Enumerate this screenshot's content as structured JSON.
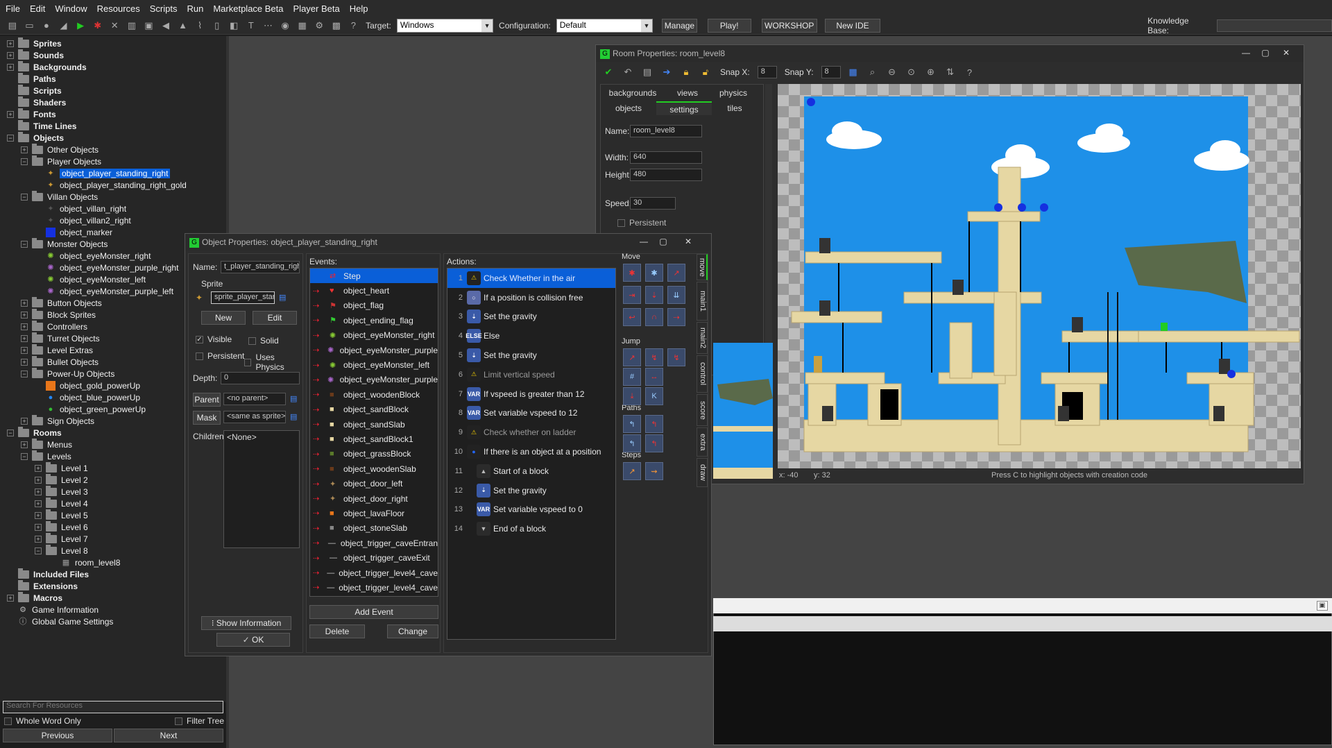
{
  "menu": [
    "File",
    "Edit",
    "Window",
    "Resources",
    "Scripts",
    "Run",
    "Marketplace Beta",
    "Player Beta",
    "Help"
  ],
  "toolbar": {
    "target_label": "Target:",
    "target_value": "Windows",
    "config_label": "Configuration:",
    "config_value": "Default",
    "manage": "Manage",
    "play": "Play!",
    "workshop": "WORKSHOP",
    "new_ide": "New IDE",
    "kb_label": "Knowledge Base:"
  },
  "tree": {
    "sprites": "Sprites",
    "sounds": "Sounds",
    "backgrounds": "Backgrounds",
    "paths": "Paths",
    "scripts": "Scripts",
    "shaders": "Shaders",
    "fonts": "Fonts",
    "timelines": "Time Lines",
    "objects": "Objects",
    "other_objects": "Other Objects",
    "player_objects": "Player Objects",
    "p1": "object_player_standing_right",
    "p2": "object_player_standing_right_gold",
    "villan_objects": "Villan Objects",
    "v1": "object_villan_right",
    "v2": "object_villan2_right",
    "v3": "object_marker",
    "monster_objects": "Monster Objects",
    "m1": "object_eyeMonster_right",
    "m2": "object_eyeMonster_purple_right",
    "m3": "object_eyeMonster_left",
    "m4": "object_eyeMonster_purple_left",
    "button_objects": "Button Objects",
    "block_sprites": "Block Sprites",
    "controllers": "Controllers",
    "turret_objects": "Turret Objects",
    "level_extras": "Level Extras",
    "bullet_objects": "Bullet Objects",
    "powerup_objects": "Power-Up Objects",
    "pu1": "object_gold_powerUp",
    "pu2": "object_blue_powerUp",
    "pu3": "object_green_powerUp",
    "sign_objects": "Sign Objects",
    "rooms": "Rooms",
    "menus": "Menus",
    "levels": "Levels",
    "l1": "Level 1",
    "l2": "Level 2",
    "l3": "Level 3",
    "l4": "Level 4",
    "l5": "Level 5",
    "l6": "Level 6",
    "l7": "Level 7",
    "l8": "Level 8",
    "room": "room_level8",
    "included": "Included Files",
    "extensions": "Extensions",
    "macros": "Macros",
    "gameinfo": "Game Information",
    "gamesettings": "Global Game Settings"
  },
  "search": {
    "placeholder": "Search For Resources",
    "whole_word": "Whole Word Only",
    "filter_tree": "Filter Tree",
    "previous": "Previous",
    "next": "Next"
  },
  "objwin": {
    "title": "Object Properties: object_player_standing_right",
    "name_label": "Name:",
    "name_value": "t_player_standing_right",
    "sprite_label": "Sprite",
    "sprite_value": "sprite_player_stan",
    "new": "New",
    "edit": "Edit",
    "visible": "Visible",
    "solid": "Solid",
    "persistent": "Persistent",
    "uses_physics": "Uses Physics",
    "depth_label": "Depth:",
    "depth_value": "0",
    "parent_label": "Parent",
    "parent_value": "<no parent>",
    "mask_label": "Mask",
    "mask_value": "<same as sprite>",
    "children_label": "Children:",
    "children_value": "<None>",
    "show_info": "Show Information",
    "ok": "OK",
    "events_label": "Events:",
    "actions_label": "Actions:",
    "add_event": "Add Event",
    "delete": "Delete",
    "change": "Change",
    "events": [
      "Step",
      "object_heart",
      "object_flag",
      "object_ending_flag",
      "object_eyeMonster_right",
      "object_eyeMonster_purple",
      "object_eyeMonster_left",
      "object_eyeMonster_purple",
      "object_woodenBlock",
      "object_sandBlock",
      "object_sandSlab",
      "object_sandBlock1",
      "object_grassBlock",
      "object_woodenSlab",
      "object_door_left",
      "object_door_right",
      "object_lavaFloor",
      "object_stoneSlab",
      "object_trigger_caveEntran",
      "object_trigger_caveExit",
      "object_trigger_level4_cave",
      "object_trigger_level4_cave"
    ],
    "actions": [
      {
        "n": "1",
        "t": "Check Whether in the air",
        "ic": "warn",
        "indent": 0
      },
      {
        "n": "2",
        "t": "If a position is collision free",
        "ic": "circle",
        "indent": 0
      },
      {
        "n": "3",
        "t": "Set the gravity",
        "ic": "grav",
        "indent": 0
      },
      {
        "n": "4",
        "t": "Else",
        "ic": "else",
        "indent": 0
      },
      {
        "n": "5",
        "t": "Set the gravity",
        "ic": "grav",
        "indent": 0
      },
      {
        "n": "6",
        "t": "Limit vertical speed",
        "ic": "warn",
        "indent": 0
      },
      {
        "n": "7",
        "t": "If vspeed is greater than 12",
        "ic": "var",
        "indent": 0
      },
      {
        "n": "8",
        "t": "Set variable vspeed to 12",
        "ic": "var",
        "indent": 0
      },
      {
        "n": "9",
        "t": "Check whether on ladder",
        "ic": "warn",
        "indent": 0
      },
      {
        "n": "10",
        "t": "If there is an object at a position",
        "ic": "ball",
        "indent": 0
      },
      {
        "n": "11",
        "t": "Start of a block",
        "ic": "up",
        "indent": 1
      },
      {
        "n": "12",
        "t": "Set the gravity",
        "ic": "grav",
        "indent": 1
      },
      {
        "n": "13",
        "t": "Set variable vspeed to 0",
        "ic": "var",
        "indent": 1
      },
      {
        "n": "14",
        "t": "End of a block",
        "ic": "down",
        "indent": 1
      }
    ],
    "pal_move": "Move",
    "pal_jump": "Jump",
    "pal_paths": "Paths",
    "pal_steps": "Steps",
    "vtabs": [
      "move",
      "main1",
      "main2",
      "control",
      "score",
      "extra",
      "draw"
    ]
  },
  "roomwin": {
    "title": "Room Properties: room_level8",
    "snapx_label": "Snap X:",
    "snapx": "8",
    "snapy_label": "Snap Y:",
    "snapy": "8",
    "tabs_top": [
      "backgrounds",
      "views",
      "physics"
    ],
    "tabs_bottom": [
      "objects",
      "settings",
      "tiles"
    ],
    "name_label": "Name:",
    "name_value": "room_level8",
    "width_label": "Width:",
    "width_value": "640",
    "height_label": "Height:",
    "height_value": "480",
    "speed_label": "Speed:",
    "speed_value": "30",
    "persistent": "Persistent",
    "status_x": "x: -40",
    "status_y": "y: 32",
    "status_hint": "Press C to highlight objects with creation code"
  },
  "colors": {
    "selection": "#0a5fd8",
    "sky": "#1e90e8",
    "sand": "#e6d7a3"
  }
}
